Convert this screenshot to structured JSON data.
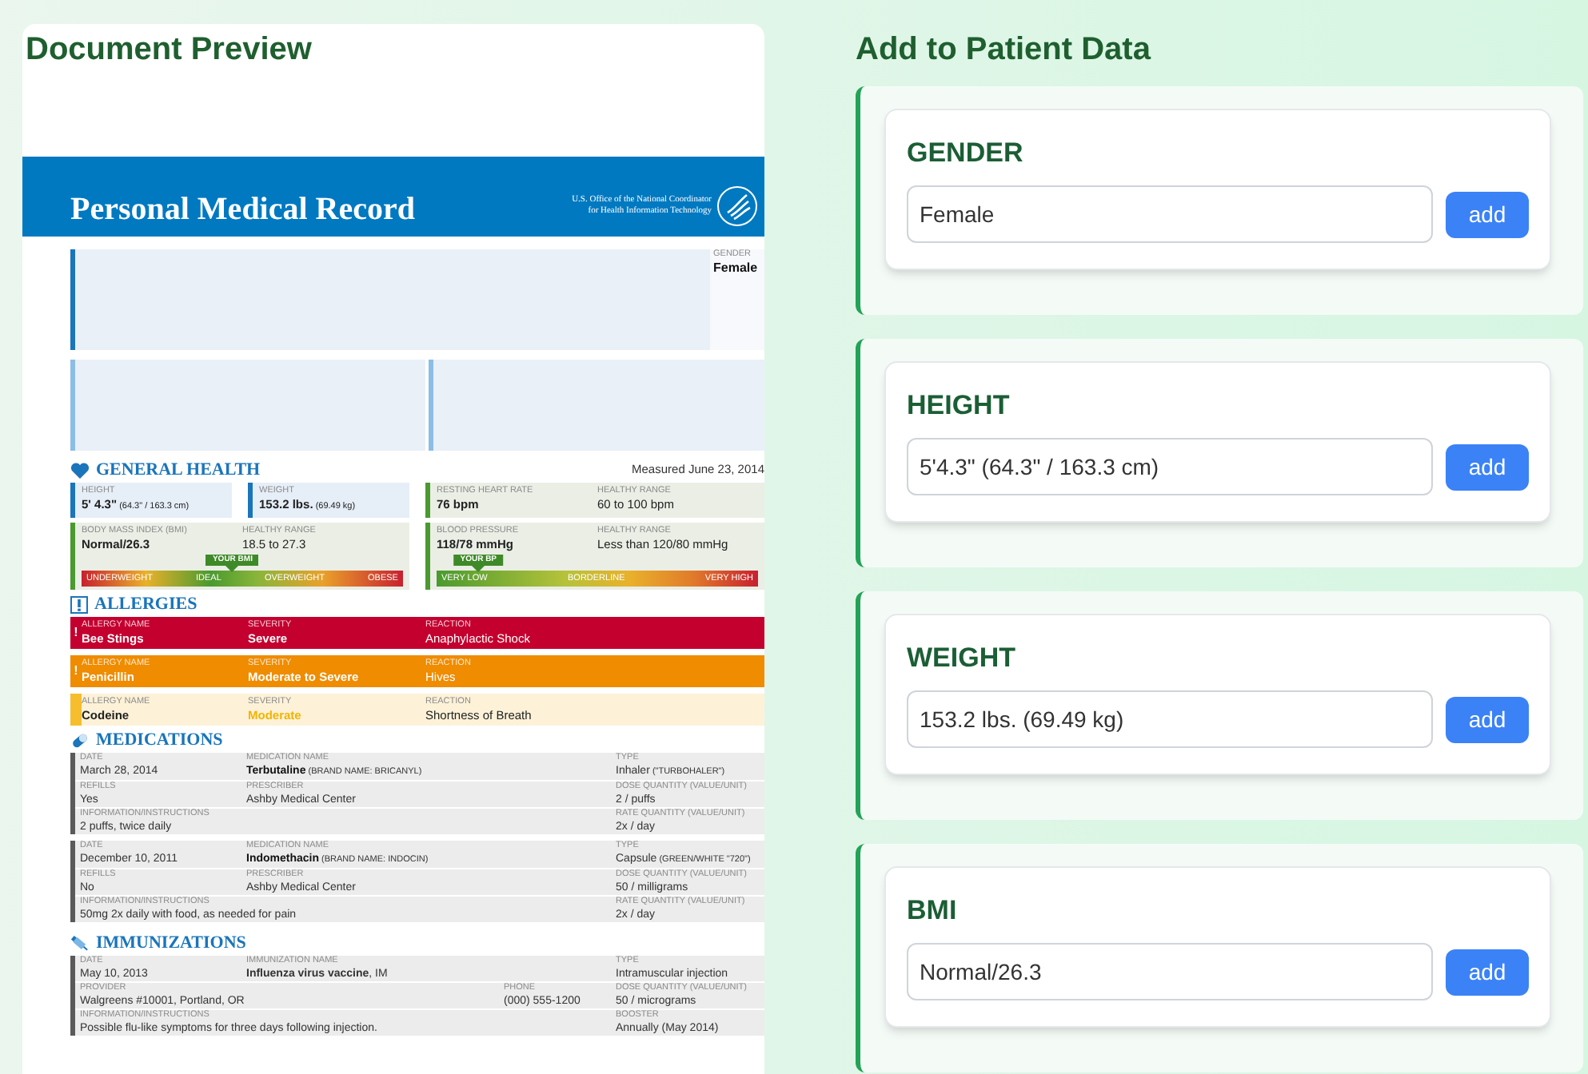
{
  "preview": {
    "title": "Document Preview"
  },
  "document": {
    "header": {
      "title": "Personal Medical Record",
      "agency": [
        "U.S. Office of the National Coordinator",
        "for Health Information Technology"
      ]
    },
    "gender": {
      "label": "GENDER",
      "value": "Female"
    },
    "general_health": {
      "title": "GENERAL HEALTH",
      "measured": "Measured June 23, 2014",
      "cards": [
        {
          "kind": "measure",
          "color": "#1b75bb",
          "fields": [
            {
              "label": "HEIGHT",
              "value": "5' 4.3\"",
              "note": "(64.3\" / 163.3 cm)"
            }
          ]
        },
        {
          "kind": "measure",
          "color": "#1b75bb",
          "fields": [
            {
              "label": "WEIGHT",
              "value": "153.2 lbs.",
              "note": "(69.49 kg)"
            }
          ]
        },
        {
          "kind": "measure",
          "color": "#4a9a2f",
          "fields": [
            {
              "label": "RESTING HEART RATE",
              "value": "76 bpm"
            },
            {
              "label": "HEALTHY RANGE",
              "value": "60 to 100 bpm",
              "kind": "plain"
            }
          ]
        },
        {
          "kind": "gauge",
          "color": "#4a9a2f",
          "fields": [
            {
              "label": "BODY MASS INDEX (BMI)",
              "value": "Normal/26.3"
            },
            {
              "label": "HEALTHY RANGE",
              "value": "18.5 to 27.3",
              "kind": "plain"
            }
          ],
          "gauge": {
            "marker": "YOUR BMI",
            "level": 0.47,
            "scale": [
              "UNDERWEIGHT",
              "IDEAL",
              "OVERWEIGHT",
              "OBESE"
            ]
          }
        },
        {
          "kind": "gauge",
          "color": "#4a9a2f",
          "fields": [
            {
              "label": "BLOOD PRESSURE",
              "value": "118/78 mmHg"
            },
            {
              "label": "HEALTHY RANGE",
              "value": "Less than 120/80 mmHg",
              "kind": "plain"
            }
          ],
          "gauge": {
            "marker": "YOUR BP",
            "level": 0.13,
            "scale": [
              "VERY LOW",
              "BORDERLINE",
              "VERY HIGH"
            ]
          }
        }
      ]
    },
    "allergies": {
      "title": "ALLERGIES",
      "rows": [
        {
          "kind": "strong",
          "color": "#c4002f",
          "flag": "!",
          "fields": [
            {
              "label": "ALLERGY NAME",
              "value": "Bee Stings"
            },
            {
              "label": "SEVERITY",
              "value": "Severe"
            },
            {
              "label": "REACTION",
              "value": "Anaphylactic Shock"
            }
          ]
        },
        {
          "kind": "strong",
          "color": "#ef8c00",
          "flag": "!",
          "fields": [
            {
              "label": "ALLERGY NAME",
              "value": "Penicillin"
            },
            {
              "label": "SEVERITY",
              "value": "Moderate to Severe"
            },
            {
              "label": "REACTION",
              "value": "Hives"
            }
          ]
        },
        {
          "kind": "light",
          "color": "#f6be2c",
          "fields": [
            {
              "label": "ALLERGY NAME",
              "value": "Codeine"
            },
            {
              "label": "SEVERITY",
              "value": "Moderate"
            },
            {
              "label": "REACTION",
              "value": "Shortness of Breath"
            }
          ]
        }
      ]
    },
    "medications": {
      "title": "MEDICATIONS",
      "entries": [
        {
          "lines": [
            {
              "fields": [
                {
                  "kind": "narrow",
                  "label": "DATE",
                  "value": "March 28, 2014"
                },
                {
                  "kind": "wide",
                  "label": "MEDICATION NAME",
                  "value": "Terbutaline",
                  "bold": true,
                  "note": "(BRAND NAME: BRICANYL)"
                },
                {
                  "kind": "narrow",
                  "label": "TYPE",
                  "value": "Inhaler",
                  "note": "(\"TURBOHALER\")"
                }
              ]
            },
            {
              "fields": [
                {
                  "kind": "narrow",
                  "label": "REFILLS",
                  "value": "Yes"
                },
                {
                  "kind": "wide",
                  "label": "PRESCRIBER",
                  "value": "Ashby Medical Center"
                },
                {
                  "kind": "narrow",
                  "label": "DOSE QUANTITY (VALUE/UNIT)",
                  "value": "2 / puffs"
                }
              ]
            },
            {
              "fields": [
                {
                  "kind": "wide",
                  "label": "INFORMATION/INSTRUCTIONS",
                  "value": "2 puffs, twice daily"
                },
                {
                  "kind": "narrow",
                  "label": "RATE QUANTITY (VALUE/UNIT)",
                  "value": "2x / day"
                }
              ]
            }
          ]
        },
        {
          "lines": [
            {
              "fields": [
                {
                  "kind": "narrow",
                  "label": "DATE",
                  "value": "December 10, 2011"
                },
                {
                  "kind": "wide",
                  "label": "MEDICATION NAME",
                  "value": "Indomethacin",
                  "bold": true,
                  "note": "(BRAND NAME: INDOCIN)"
                },
                {
                  "kind": "narrow",
                  "label": "TYPE",
                  "value": "Capsule",
                  "note": "(GREEN/WHITE \"720\")"
                }
              ]
            },
            {
              "fields": [
                {
                  "kind": "narrow",
                  "label": "REFILLS",
                  "value": "No"
                },
                {
                  "kind": "wide",
                  "label": "PRESCRIBER",
                  "value": "Ashby Medical Center"
                },
                {
                  "kind": "narrow",
                  "label": "DOSE QUANTITY (VALUE/UNIT)",
                  "value": "50 / milligrams"
                }
              ]
            },
            {
              "fields": [
                {
                  "kind": "wide",
                  "label": "INFORMATION/INSTRUCTIONS",
                  "value": "50mg 2x daily with food, as needed for pain"
                },
                {
                  "kind": "narrow",
                  "label": "RATE QUANTITY (VALUE/UNIT)",
                  "value": "2x / day"
                }
              ]
            }
          ]
        }
      ]
    },
    "immunizations": {
      "title": "IMMUNIZATIONS",
      "entries": [
        {
          "lines": [
            {
              "fields": [
                {
                  "kind": "narrow",
                  "label": "DATE",
                  "value": "May 10, 2013"
                },
                {
                  "kind": "wide",
                  "label": "IMMUNIZATION NAME",
                  "value": "**Influenza virus vaccine**, IM"
                },
                {
                  "kind": "narrow",
                  "label": "TYPE",
                  "value": "Intramuscular injection"
                }
              ]
            },
            {
              "fields": [
                {
                  "kind": "wide",
                  "label": "PROVIDER",
                  "value": "Walgreens #10001, Portland, OR"
                },
                {
                  "kind": "narrow",
                  "label": "PHONE",
                  "value": "(000) 555-1200"
                },
                {
                  "kind": "narrow",
                  "label": "DOSE QUANTITY (VALUE/UNIT)",
                  "value": "50 / micrograms"
                }
              ]
            },
            {
              "fields": [
                {
                  "kind": "wide",
                  "label": "INFORMATION/INSTRUCTIONS",
                  "value": "Possible flu-like symptoms for three days following injection."
                },
                {
                  "kind": "narrow",
                  "label": "BOOSTER",
                  "value": "Annually (May 2014)"
                }
              ]
            }
          ]
        }
      ]
    }
  },
  "patient_data": {
    "title": "Add to Patient Data",
    "fields": [
      {
        "label": "GENDER",
        "value": "Female",
        "button": "add"
      },
      {
        "label": "HEIGHT",
        "value": "5'4.3\" (64.3\" / 163.3 cm)",
        "button": "add"
      },
      {
        "label": "WEIGHT",
        "value": "153.2 lbs. (69.49 kg)",
        "button": "add"
      },
      {
        "label": "BMI",
        "value": "Normal/26.3",
        "button": "add"
      }
    ]
  }
}
